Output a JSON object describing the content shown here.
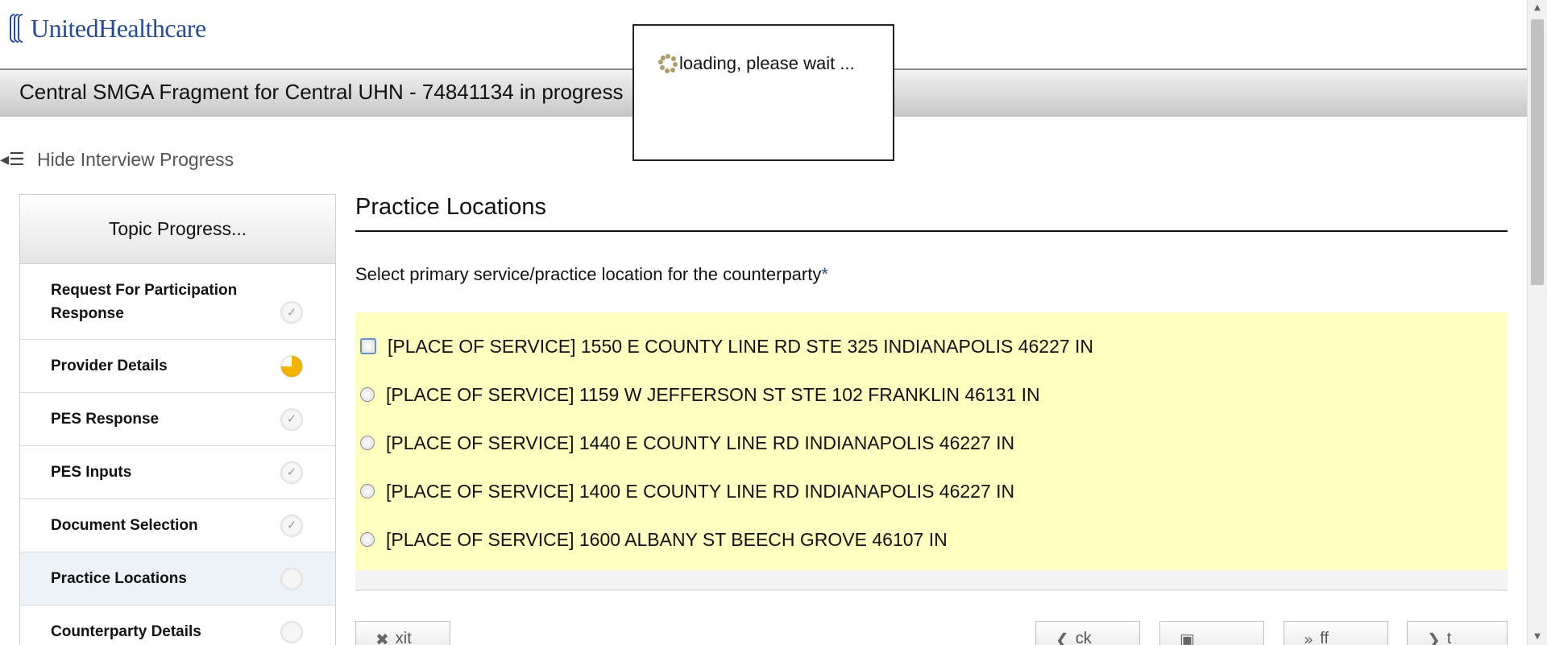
{
  "brand": {
    "logo_text": "UnitedHealthcare"
  },
  "header": {
    "title": "Central SMGA Fragment for Central UHN - 74841134 in progress"
  },
  "progress_toggle": {
    "icon": "list-collapse-icon",
    "label": "Hide Interview Progress"
  },
  "sidebar": {
    "title": "Topic Progress...",
    "topics": [
      {
        "label": "Request For Participation Response",
        "status": "complete"
      },
      {
        "label": "Provider Details",
        "status": "in-progress"
      },
      {
        "label": "PES Response",
        "status": "complete"
      },
      {
        "label": "PES Inputs",
        "status": "complete"
      },
      {
        "label": "Document Selection",
        "status": "complete"
      },
      {
        "label": "Practice Locations",
        "status": "not-started",
        "active": true
      },
      {
        "label": "Counterparty Details",
        "status": "not-started"
      }
    ]
  },
  "main": {
    "section_title": "Practice Locations",
    "question": "Select primary service/practice location for the counterparty",
    "required_marker": "*",
    "options": [
      "[PLACE OF SERVICE] 1550 E COUNTY LINE RD STE 325 INDIANAPOLIS 46227 IN",
      "[PLACE OF SERVICE] 1159 W JEFFERSON ST STE 102 FRANKLIN 46131 IN",
      "[PLACE OF SERVICE] 1440 E COUNTY LINE RD INDIANAPOLIS 46227 IN",
      "[PLACE OF SERVICE] 1400 E COUNTY LINE RD INDIANAPOLIS 46227 IN",
      "[PLACE OF SERVICE] 1600 ALBANY ST BEECH GROVE 46107 IN"
    ]
  },
  "footer_buttons": [
    {
      "icon": "close-icon",
      "label": "xit"
    },
    {
      "icon": "chevron-left-icon",
      "label": "ck"
    },
    {
      "icon": "save-icon",
      "label": ""
    },
    {
      "icon": "fast-forward-icon",
      "label": "ff"
    },
    {
      "icon": "chevron-right-icon",
      "label": "t"
    }
  ],
  "loading_dialog": {
    "text": "loading, please wait ..."
  },
  "colors": {
    "brand_blue": "#2a4b8d",
    "option_highlight": "#ffffc2",
    "in_progress": "#f5b400"
  }
}
